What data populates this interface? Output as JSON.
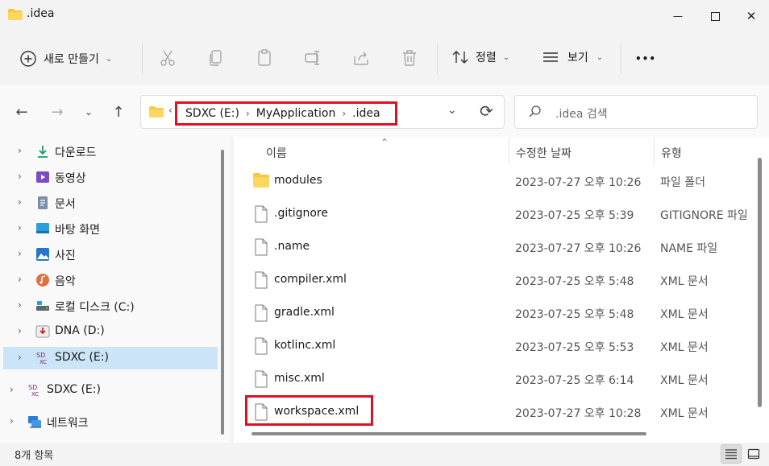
{
  "window": {
    "title": ".idea",
    "minimize_glyph": "—",
    "maximize_glyph": "☐",
    "close_glyph": "✕"
  },
  "toolbar": {
    "new_label": "새로 만들기",
    "sort_label": "정렬",
    "view_label": "보기",
    "more_glyph": "•••",
    "icons": [
      "cut-icon",
      "copy-icon",
      "paste-icon",
      "rename-icon",
      "share-icon",
      "delete-icon"
    ]
  },
  "address": {
    "overflow_glyph": "‹",
    "crumbs": [
      "SDXC (E:)",
      "MyApplication",
      ".idea"
    ],
    "search_placeholder": ".idea 검색"
  },
  "sidebar": {
    "items": [
      {
        "label": "다운로드",
        "icon": "download-icon"
      },
      {
        "label": "동영상",
        "icon": "video-icon"
      },
      {
        "label": "문서",
        "icon": "document-icon"
      },
      {
        "label": "바탕 화면",
        "icon": "desktop-icon"
      },
      {
        "label": "사진",
        "icon": "pictures-icon"
      },
      {
        "label": "음악",
        "icon": "music-icon"
      },
      {
        "label": "로컬 디스크 (C:)",
        "icon": "local-disk-icon"
      },
      {
        "label": "DNA (D:)",
        "icon": "drive-icon"
      },
      {
        "label": "SDXC (E:)",
        "icon": "sd-card-icon"
      },
      {
        "label": "SDXC (E:)",
        "icon": "sd-card-icon"
      },
      {
        "label": "네트워크",
        "icon": "network-icon"
      }
    ],
    "selected_index": 8
  },
  "columns": {
    "name": "이름",
    "date": "수정한 날짜",
    "type": "유형"
  },
  "files": [
    {
      "name": "modules",
      "date": "2023-07-27 오후 10:26",
      "type": "파일 폴더",
      "kind": "folder"
    },
    {
      "name": ".gitignore",
      "date": "2023-07-25 오후 5:39",
      "type": "GITIGNORE 파일",
      "kind": "file"
    },
    {
      "name": ".name",
      "date": "2023-07-27 오후 10:26",
      "type": "NAME 파일",
      "kind": "file"
    },
    {
      "name": "compiler.xml",
      "date": "2023-07-25 오후 5:48",
      "type": "XML 문서",
      "kind": "file"
    },
    {
      "name": "gradle.xml",
      "date": "2023-07-25 오후 5:48",
      "type": "XML 문서",
      "kind": "file"
    },
    {
      "name": "kotlinc.xml",
      "date": "2023-07-25 오후 5:53",
      "type": "XML 문서",
      "kind": "file"
    },
    {
      "name": "misc.xml",
      "date": "2023-07-25 오후 6:14",
      "type": "XML 문서",
      "kind": "file"
    },
    {
      "name": "workspace.xml",
      "date": "2023-07-27 오후 10:28",
      "type": "XML 문서",
      "kind": "file"
    }
  ],
  "status": {
    "item_count": "8개 항목"
  },
  "colors": {
    "highlight": "#e0101e",
    "selection": "#cce4f7",
    "folder": "#f8c93e"
  }
}
